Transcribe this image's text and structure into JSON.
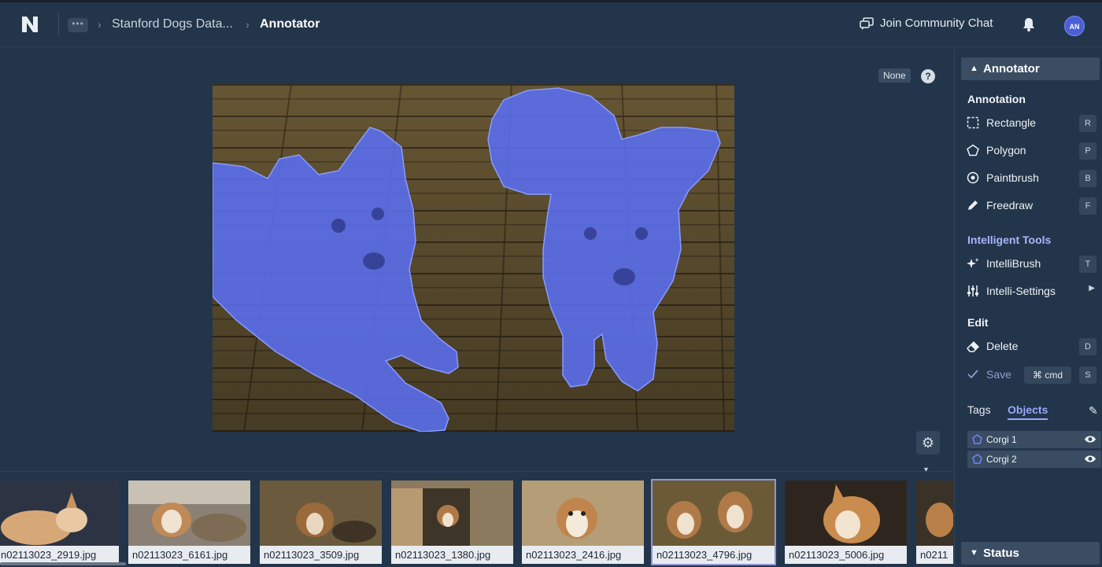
{
  "header": {
    "breadcrumb": [
      {
        "label": "Stanford Dogs Data..."
      },
      {
        "label": "Annotator"
      }
    ],
    "community_label": "Join Community Chat",
    "avatar_initials": "AN"
  },
  "canvas": {
    "zoom_badge": "None",
    "help_glyph": "?",
    "annotation_color": "#5a6ef0"
  },
  "filmstrip": {
    "thumbnails": [
      {
        "file": "n02113023_2919.jpg"
      },
      {
        "file": "n02113023_6161.jpg"
      },
      {
        "file": "n02113023_3509.jpg"
      },
      {
        "file": "n02113023_1380.jpg"
      },
      {
        "file": "n02113023_2416.jpg"
      },
      {
        "file": "n02113023_4796.jpg",
        "selected": true
      },
      {
        "file": "n02113023_5006.jpg"
      },
      {
        "file": "n0211"
      }
    ]
  },
  "panel": {
    "title": "Annotator",
    "annotation_section": "Annotation",
    "tools": [
      {
        "label": "Rectangle",
        "key": "R",
        "icon": "rectangle-icon"
      },
      {
        "label": "Polygon",
        "key": "P",
        "icon": "polygon-icon"
      },
      {
        "label": "Paintbrush",
        "key": "B",
        "icon": "paintbrush-icon"
      },
      {
        "label": "Freedraw",
        "key": "F",
        "icon": "pencil-icon"
      }
    ],
    "intelligent_section": "Intelligent Tools",
    "intelli_tools": [
      {
        "label": "IntelliBrush",
        "key": "T",
        "icon": "sparkle-icon"
      },
      {
        "label": "Intelli-Settings",
        "icon": "sliders-icon"
      }
    ],
    "edit_section": "Edit",
    "edit_tools": [
      {
        "label": "Delete",
        "key": "D",
        "icon": "eraser-icon"
      },
      {
        "label": "Save",
        "key": "S",
        "cmd": "cmd",
        "icon": "check-icon"
      }
    ],
    "tabs": [
      {
        "label": "Tags"
      },
      {
        "label": "Objects",
        "active": true
      }
    ],
    "objects": [
      {
        "label": "Corgi 1"
      },
      {
        "label": "Corgi 2"
      }
    ],
    "status_title": "Status"
  }
}
